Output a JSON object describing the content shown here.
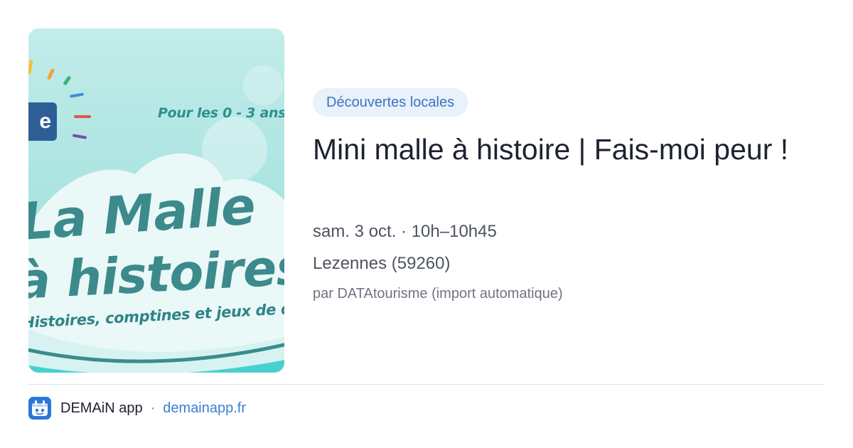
{
  "thumbnail": {
    "badge_letter": "e",
    "age_text": "Pour les 0 - 3 ans",
    "headline_1": "La Malle",
    "headline_2": "à histoires",
    "subline": "Histoires, comptines et jeux de doigts"
  },
  "event": {
    "category": "Découvertes locales",
    "title": "Mini malle à histoire | Fais-moi peur !",
    "datetime": "sam. 3 oct. · 10h–10h45",
    "location": "Lezennes (59260)",
    "source": "par DATAtourisme (import automatique)"
  },
  "footer": {
    "app_icon": "app-logo-icon",
    "app_name": "DEMAiN app",
    "separator": "·",
    "domain": "demainapp.fr"
  },
  "colors": {
    "chip_bg": "#e9f1fb",
    "chip_text": "#3a75bf",
    "title": "#1e2230",
    "link": "#3a7fd0",
    "thumbnail_teal": "#3d8a8c"
  }
}
